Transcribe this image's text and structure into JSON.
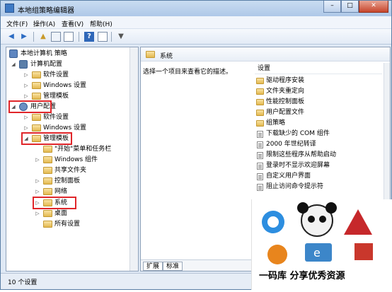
{
  "window": {
    "title": "本地组策略编辑器",
    "buttons": [
      "–",
      "□",
      "✕"
    ]
  },
  "menu": [
    "文件(F)",
    "操作(A)",
    "查看(V)",
    "帮助(H)"
  ],
  "toolbar_icons": [
    "back-arrow-icon",
    "forward-arrow-icon",
    "up-folder-icon",
    "show-tree-icon",
    "export-icon",
    "help-icon",
    "properties-icon",
    "filter-icon"
  ],
  "tree": {
    "root": "本地计算机 策略",
    "computer_config": "计算机配置",
    "cc_software": "软件设置",
    "cc_windows": "Windows 设置",
    "cc_admin": "管理模板",
    "user_config": "用户配置",
    "uc_software": "软件设置",
    "uc_windows": "Windows 设置",
    "uc_admin": "管理模板",
    "start_menu": "\"开始\"菜单和任务栏",
    "windows_components": "Windows 组件",
    "shared_folders": "共享文件夹",
    "control_panel": "控制面板",
    "network": "网络",
    "system": "系统",
    "desktop": "桌面",
    "all_settings": "所有设置"
  },
  "right": {
    "header": "系统",
    "description": "选择一个项目来查看它的描述。",
    "column": "设置",
    "items": [
      {
        "type": "folder",
        "label": "驱动程序安装"
      },
      {
        "type": "folder",
        "label": "文件夹重定向"
      },
      {
        "type": "folder",
        "label": "性能控制面板"
      },
      {
        "type": "folder",
        "label": "用户配置文件"
      },
      {
        "type": "folder",
        "label": "组策略"
      },
      {
        "type": "setting",
        "label": "下载缺少的 COM 组件"
      },
      {
        "type": "setting",
        "label": "2000 年世纪转译"
      },
      {
        "type": "setting",
        "label": "限制这些程序从帮助启动"
      },
      {
        "type": "setting",
        "label": "登录时不显示欢迎屏幕"
      },
      {
        "type": "setting",
        "label": "自定义用户界面"
      },
      {
        "type": "setting",
        "label": "阻止访问命令提示符"
      }
    ],
    "tabs": [
      "扩展",
      "标准"
    ]
  },
  "status": "10 个设置",
  "ad": {
    "caption": "一码库  分享优秀资源"
  }
}
